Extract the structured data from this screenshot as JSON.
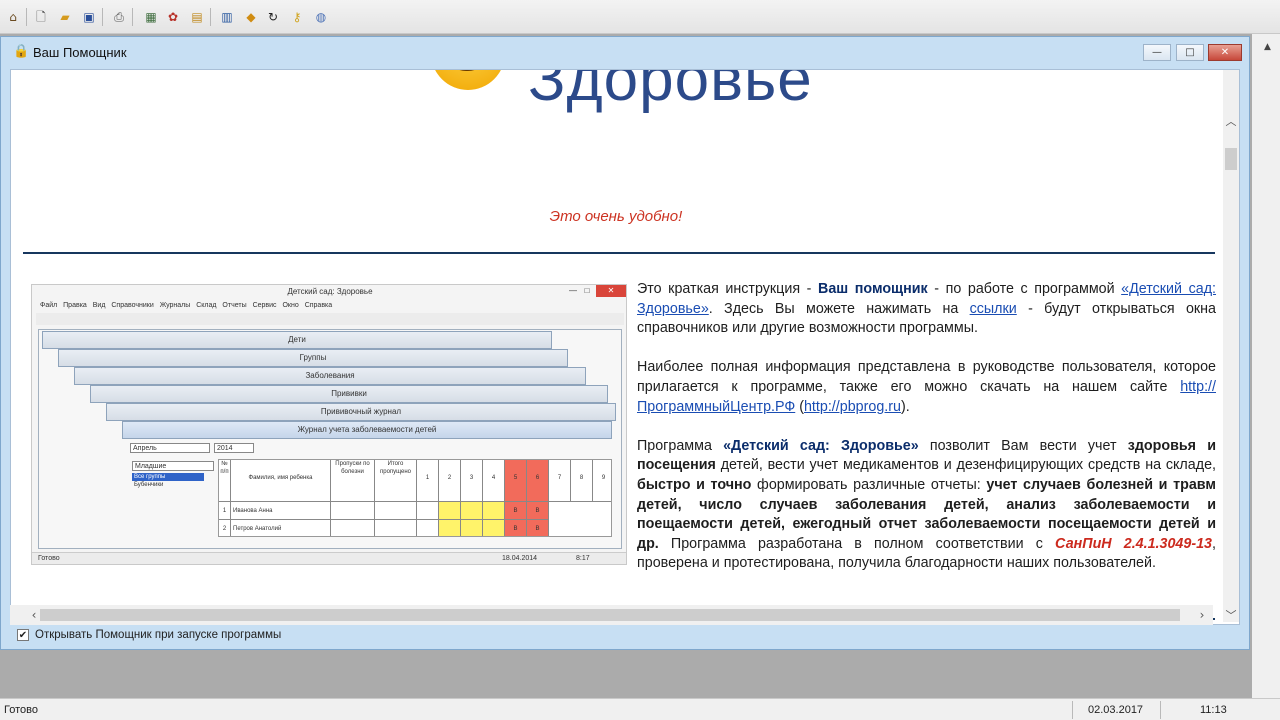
{
  "toolbar": {
    "icons": [
      "home-icon",
      "new-file-icon",
      "open-folder-icon",
      "save-icon",
      "print-icon",
      "calendar-icon",
      "settings-icon",
      "lock-icon",
      "table-icon",
      "diamond-icon",
      "refresh-icon",
      "key-icon",
      "globe-icon"
    ]
  },
  "window": {
    "title": "Ваш Помощник",
    "minimize_glyph": "—",
    "maximize_glyph": "□",
    "close_glyph": "✕"
  },
  "content": {
    "logo_text": "Здоровье",
    "tagline": "Это очень удобно!",
    "screenshot": {
      "app_title": "Детский сад: Здоровье",
      "menu": "Файл  Правка  Вид  Справочники  Журналы  Склад  Отчеты  Сервис  Окно  Справка",
      "windows": [
        "Дети",
        "Группы",
        "Заболевания",
        "Прививки",
        "Прививочный журнал",
        "Журнал учета заболеваемости детей"
      ],
      "filter_month": "Апрель",
      "filter_year": "2014",
      "group_select": "Младшие",
      "groups": [
        "Все группы",
        "Бубенчики"
      ],
      "grid_headers": [
        "№ п/п",
        "Фамилия, имя ребенка",
        "Пропуски по болезни",
        "Итого пропущено"
      ],
      "day_headers": [
        "1",
        "2",
        "3",
        "4",
        "5",
        "6",
        "7",
        "8",
        "9"
      ],
      "rows": [
        {
          "n": "1",
          "name": "Иванова Анна"
        },
        {
          "n": "2",
          "name": "Петров Анатолий"
        }
      ],
      "mark": "В",
      "status_left": "Готово",
      "status_date": "18.04.2014",
      "status_time": "8:17"
    },
    "intro": {
      "t1": "Это краткая инструкция - ",
      "b1": "Ваш помощник",
      "t2": " - по работе с программой ",
      "link1": "«Детский сад: Здоровье»",
      "t3": ". Здесь Вы можете нажимать на ",
      "link2": "ссылки",
      "t4": " - будут открываться окна справочников или другие возможности программы."
    },
    "info": {
      "t1": "Наиболее полная информация представлена в руководстве пользователя, которое прилагается к программе, также его можно скачать на нашем сайте ",
      "link1": "http://ПрограммныйЦентр.РФ",
      "t2": " (",
      "link2": "http://pbprog.ru",
      "t3": ")."
    },
    "program": {
      "t1": "Программа ",
      "b1": "«Детский сад: Здоровье»",
      "t2": " позволит Вам вести учет ",
      "b2": "здоровья и посещения",
      "t3": " детей, вести учет медикаментов и дезенфицирующих средств на складе, ",
      "b3": "быстро и точно",
      "t4": " формировать различные отчеты: ",
      "b4": "учет случаев болезней и травм детей, число случаев заболевания детей, анализ заболеваемости и поещаемости детей, ежегодный отчет заболеваемости посещаемости детей и др.",
      "t5": " Программа разработана в полном соответствии с ",
      "red": "СанПиН 2.4.1.3049-13",
      "t6": ", проверена и протестирована, получила благодарности наших пользователей."
    }
  },
  "startup_checkbox": {
    "checked": true,
    "glyph": "✔",
    "label": "Открывать Помощник при запуске программы"
  },
  "statusbar": {
    "left": "Готово",
    "date": "02.03.2017",
    "time": "11:13"
  }
}
